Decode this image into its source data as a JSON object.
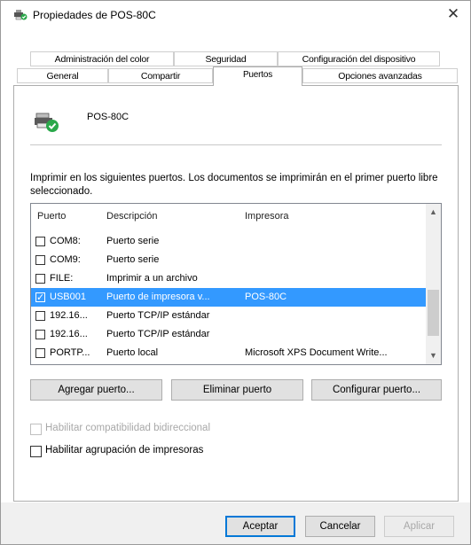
{
  "window": {
    "title": "Propiedades de POS-80C",
    "close_symbol": "✕"
  },
  "tabs": {
    "row1": [
      "Administración del color",
      "Seguridad",
      "Configuración del dispositivo"
    ],
    "row2": [
      "General",
      "Compartir",
      "Puertos",
      "Opciones avanzadas"
    ],
    "active": "Puertos"
  },
  "printer": {
    "name": "POS-80C",
    "icon": "printer-shared-icon"
  },
  "description": "Imprimir en los siguientes puertos. Los documentos se imprimirán en el primer puerto libre seleccionado.",
  "ports": {
    "headers": [
      "Puerto",
      "Descripción",
      "Impresora"
    ],
    "rows": [
      {
        "port": "COM8:",
        "description": "Puerto serie",
        "printer": "",
        "checked": false,
        "selected": false
      },
      {
        "port": "COM9:",
        "description": "Puerto serie",
        "printer": "",
        "checked": false,
        "selected": false
      },
      {
        "port": "FILE:",
        "description": "Imprimir a un archivo",
        "printer": "",
        "checked": false,
        "selected": false
      },
      {
        "port": "USB001",
        "description": "Puerto de impresora v...",
        "printer": "POS-80C",
        "checked": true,
        "selected": true
      },
      {
        "port": "192.16...",
        "description": "Puerto TCP/IP estándar",
        "printer": "",
        "checked": false,
        "selected": false
      },
      {
        "port": "192.16...",
        "description": "Puerto TCP/IP estándar",
        "printer": "",
        "checked": false,
        "selected": false
      },
      {
        "port": "PORTP...",
        "description": "Puerto local",
        "printer": "Microsoft XPS Document Write...",
        "checked": false,
        "selected": false
      }
    ]
  },
  "port_buttons": {
    "add": "Agregar puerto...",
    "delete": "Eliminar puerto",
    "configure": "Configurar puerto..."
  },
  "options": {
    "bidirectional": {
      "label": "Habilitar compatibilidad bidireccional",
      "checked": false,
      "enabled": false
    },
    "pooling": {
      "label": "Habilitar agrupación de impresoras",
      "checked": false,
      "enabled": true
    }
  },
  "dialog_buttons": {
    "ok": "Aceptar",
    "cancel": "Cancelar",
    "apply": "Aplicar"
  },
  "colors": {
    "selection": "#3399ff",
    "accent": "#0078d7"
  }
}
